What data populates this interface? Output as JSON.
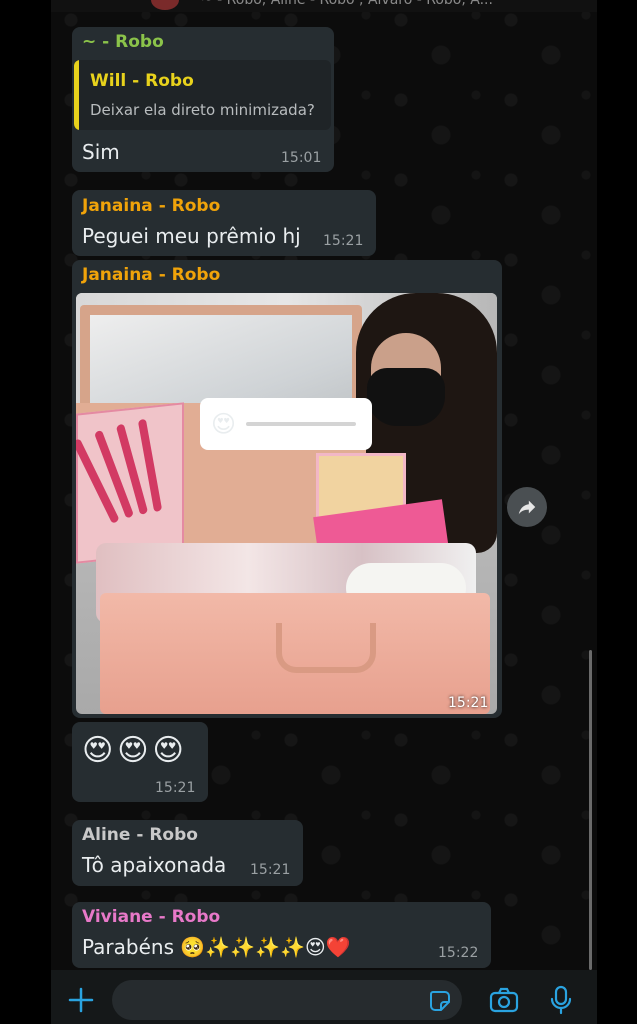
{
  "header": {
    "title": "~ - Robo, Aline - Robo , Alvaro - Robo, A..."
  },
  "messages": [
    {
      "sender": "~ - Robo",
      "sender_color": "#8bc34a",
      "quote": {
        "sender": "Will - Robo",
        "sender_color": "#e8d21c",
        "text": "Deixar ela direto minimizada?"
      },
      "text": "Sim",
      "time": "15:01"
    },
    {
      "sender": "Janaina - Robo",
      "sender_color": "#f0a30a",
      "text": "Peguei meu prêmio hj",
      "time": "15:21"
    },
    {
      "sender": "Janaina - Robo",
      "sender_color": "#f0a30a",
      "image": {
        "description_icon": "photo-makeup-case",
        "sticker_emoji": "😍",
        "slider_value": 0.0
      },
      "time": "15:21"
    },
    {
      "text": "😍😍😍",
      "time": "15:21"
    },
    {
      "sender": "Aline - Robo",
      "sender_color": "#c9c9c9",
      "text": "Tô apaixonada",
      "time": "15:21"
    },
    {
      "sender": "Viviane - Robo",
      "sender_color": "#e879c9",
      "text": "Parabéns 🥺✨✨✨✨😍❤️",
      "time": "15:22"
    }
  ],
  "input": {
    "placeholder": "",
    "icons": [
      "plus-icon",
      "sticker-icon",
      "camera-icon",
      "microphone-icon"
    ],
    "accent": "#2aa3e0"
  },
  "forward_icon": "forward-icon"
}
